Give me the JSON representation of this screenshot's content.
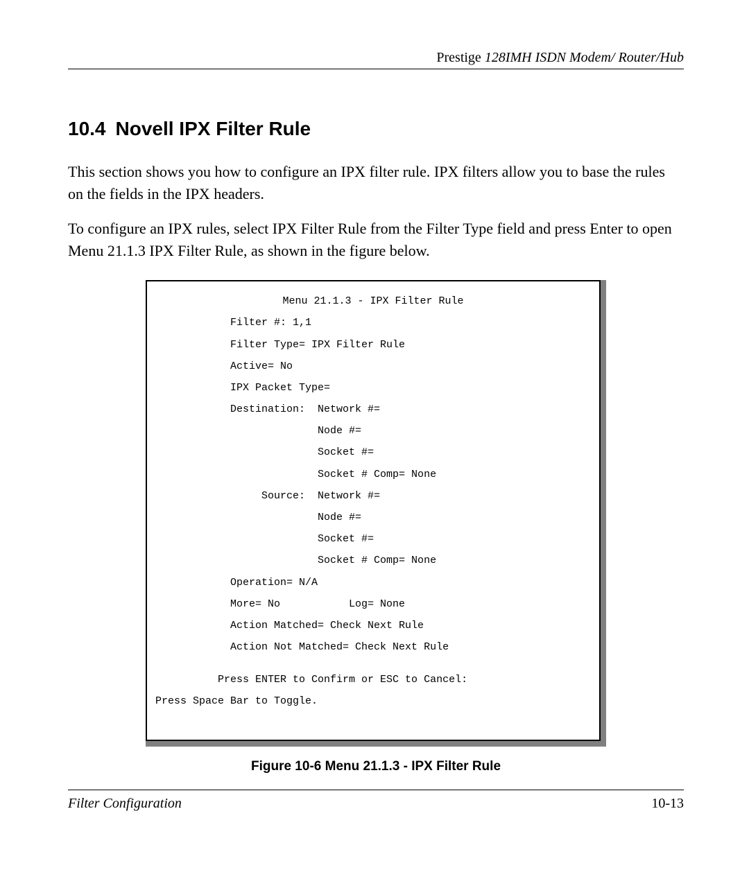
{
  "header": {
    "product": "Prestige ",
    "model": "128IMH  ISDN Modem/ Router/Hub"
  },
  "section": {
    "number": "10.4",
    "title": "Novell IPX Filter Rule"
  },
  "paragraphs": [
    "This section shows you how to configure an IPX filter rule.  IPX filters allow you to base the rules on the fields in the IPX headers.",
    "To configure an IPX rules, select IPX Filter Rule from the Filter Type field and press Enter to open Menu 21.1.3 IPX Filter Rule, as shown in the figure below."
  ],
  "terminal": {
    "title": "Menu 21.1.3 - IPX Filter Rule",
    "lines": [
      "            Filter #: 1,1",
      "            Filter Type= IPX Filter Rule",
      "            Active= No",
      "            IPX Packet Type=",
      "            Destination:  Network #=",
      "                          Node #=",
      "                          Socket #=",
      "                          Socket # Comp= None",
      "                 Source:  Network #=",
      "                          Node #=",
      "                          Socket #=",
      "                          Socket # Comp= None",
      "            Operation= N/A",
      "            More= No           Log= None",
      "            Action Matched= Check Next Rule",
      "            Action Not Matched= Check Next Rule",
      "",
      "          Press ENTER to Confirm or ESC to Cancel:",
      "Press Space Bar to Toggle."
    ]
  },
  "figure_caption": "Figure 10-6 Menu 21.1.3 - IPX Filter Rule",
  "footer": {
    "left": "Filter Configuration",
    "right": "10-13"
  }
}
